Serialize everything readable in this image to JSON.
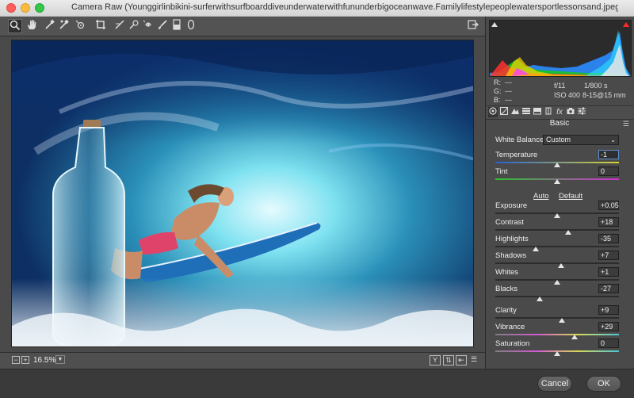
{
  "window": {
    "title": "Camera Raw (Younggirlinbikini-surferwithsurfboarddiveunderwaterwithfununderbigoceanwave.Familylifestylepeoplewatersportlessonsand.jpeg)"
  },
  "toolbar": {
    "tools": [
      "zoom-icon",
      "hand-icon",
      "white-balance-icon",
      "color-sampler-icon",
      "targeted-adjustment-icon",
      "crop-icon",
      "straighten-icon",
      "spot-removal-icon",
      "red-eye-icon",
      "adjustment-brush-icon",
      "graduated-filter-icon",
      "radial-filter-icon"
    ],
    "export_icon": "export-icon"
  },
  "status": {
    "zoom": "16.5%"
  },
  "histogram": {
    "r_label": "R:",
    "r_value": "---",
    "g_label": "G:",
    "g_value": "---",
    "b_label": "B:",
    "b_value": "---",
    "aperture": "f/11",
    "shutter": "1/800 s",
    "iso": "ISO 400",
    "lens": "8-15@15 mm"
  },
  "panel": {
    "section_title": "Basic",
    "white_balance_label": "White Balance:",
    "white_balance_value": "Custom",
    "auto_label": "Auto",
    "default_label": "Default",
    "sliders": [
      {
        "label": "Temperature",
        "value": "-1",
        "level": 0.5
      },
      {
        "label": "Tint",
        "value": "0",
        "level": 0.5
      },
      {
        "label": "Exposure",
        "value": "+0.05",
        "level": 0.5
      },
      {
        "label": "Contrast",
        "value": "+18",
        "level": 0.59
      },
      {
        "label": "Highlights",
        "value": "-35",
        "level": 0.33
      },
      {
        "label": "Shadows",
        "value": "+7",
        "level": 0.53
      },
      {
        "label": "Whites",
        "value": "+1",
        "level": 0.5
      },
      {
        "label": "Blacks",
        "value": "-27",
        "level": 0.36
      },
      {
        "label": "Clarity",
        "value": "+9",
        "level": 0.54
      },
      {
        "label": "Vibrance",
        "value": "+29",
        "level": 0.64
      },
      {
        "label": "Saturation",
        "value": "0",
        "level": 0.5
      }
    ]
  },
  "buttons": {
    "cancel": "Cancel",
    "ok": "OK"
  },
  "colors": {
    "accent": "#5d8fd0"
  }
}
